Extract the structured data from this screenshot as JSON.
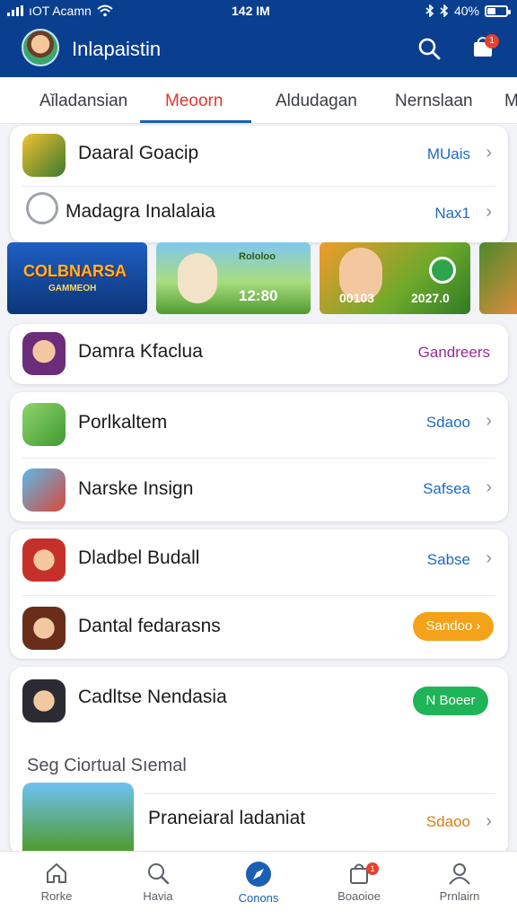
{
  "status": {
    "carrier": "ıOT Acamn",
    "time": "142 IM",
    "battery": "40%"
  },
  "header": {
    "title": "Inlapaistin"
  },
  "tabs": [
    {
      "label": "Aǐladansian"
    },
    {
      "label": "Meoorn"
    },
    {
      "label": "Aldudagan"
    },
    {
      "label": "Nernslaan"
    },
    {
      "label": "M"
    }
  ],
  "list1": [
    {
      "label": "Daaral Goacip",
      "meta": "MUais"
    },
    {
      "label": "Madagra Inalalaia",
      "meta": "Nax1"
    }
  ],
  "banners": [
    {
      "title": "COLBNARSA",
      "subtitle": "GAMMEOH"
    },
    {
      "title": "Rololoo",
      "value": "12:80"
    },
    {
      "value1": "00103",
      "value2": "2027.0"
    }
  ],
  "list2": [
    {
      "label": "Damra Kfaclua",
      "meta": "Gandreers"
    }
  ],
  "list3": [
    {
      "label": "Porlkaltem",
      "meta": "Sdaoo"
    },
    {
      "label": "Narske Insign",
      "meta": "Safsea"
    }
  ],
  "list4": [
    {
      "label": "Dladbel Budall",
      "meta": "Sabse"
    },
    {
      "label": "Dantal fedarasns",
      "button": "Sandoo"
    }
  ],
  "list5": [
    {
      "label": "Cadltse Nendasia",
      "button": "N Boeer"
    }
  ],
  "section": {
    "title": "Seg Ciortual Sıemal"
  },
  "featured": {
    "label": "Praneiaral ladaniat",
    "meta": "Sdaoo"
  },
  "nav": [
    {
      "label": "Rorke"
    },
    {
      "label": "Havia"
    },
    {
      "label": "Conons"
    },
    {
      "label": "Boaoioe"
    },
    {
      "label": "Prnlairn"
    }
  ],
  "colors": {
    "appbar": "#0a3f8f",
    "accent": "#1a5fb4",
    "active_tab": "#e0362c",
    "orange_button": "#f3a21a",
    "green_button": "#1fb457"
  }
}
